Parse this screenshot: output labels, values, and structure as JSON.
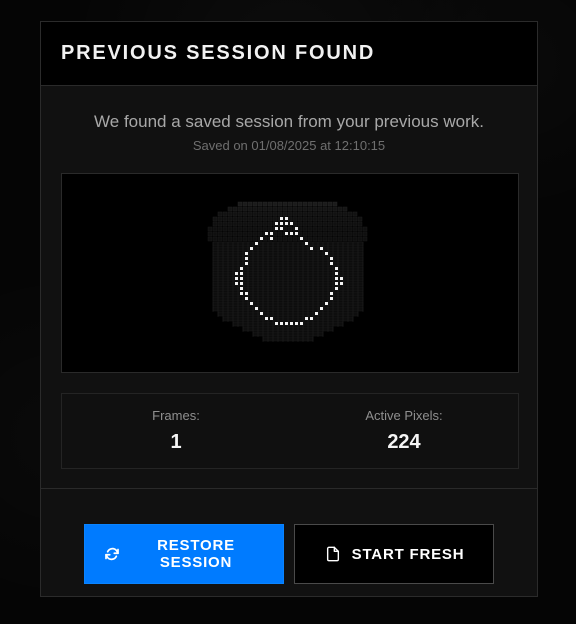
{
  "modal": {
    "title": "PREVIOUS SESSION FOUND",
    "message": "We found a saved session from your previous work.",
    "saved_time": "Saved on 01/08/2025 at 12:10:15"
  },
  "preview": {
    "icon": "refresh-icon",
    "background_color": "#000000",
    "grid_color": "#1c1c1c",
    "pixel_color": "#ffffff"
  },
  "stats": {
    "frames_label": "Frames:",
    "frames_value": "1",
    "active_pixels_label": "Active Pixels:",
    "active_pixels_value": "224"
  },
  "actions": {
    "restore_label": "RESTORE\nSESSION",
    "restore_icon": "refresh-icon",
    "start_fresh_label": "START FRESH",
    "start_fresh_icon": "file-icon"
  },
  "colors": {
    "accent": "#007bff",
    "panel": "#111111",
    "text": "#f2f2f2"
  }
}
